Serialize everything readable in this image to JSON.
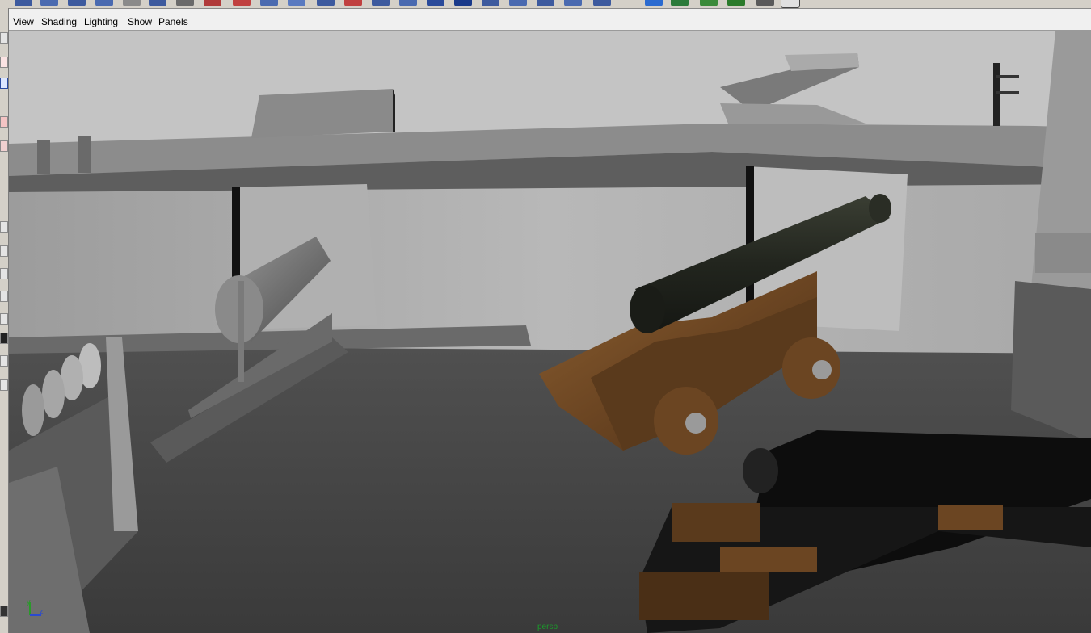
{
  "menubar": {
    "items": [
      {
        "label": "View"
      },
      {
        "label": "Shading"
      },
      {
        "label": "Lighting"
      },
      {
        "label": "Show"
      },
      {
        "label": "Panels"
      }
    ]
  },
  "viewport": {
    "camera_label": "persp",
    "axis": {
      "y": "y",
      "z": "z"
    }
  },
  "colors": {
    "ui_bg": "#f0f0f0",
    "shelf_bg": "#d4d0c8",
    "wood": "#7a5530",
    "iron": "#2b2e25",
    "camera_label": "#1a9a2a"
  },
  "icons": {
    "shelf": "shelf-tool-icons",
    "gizmo": "axis-gizmo-icon"
  }
}
